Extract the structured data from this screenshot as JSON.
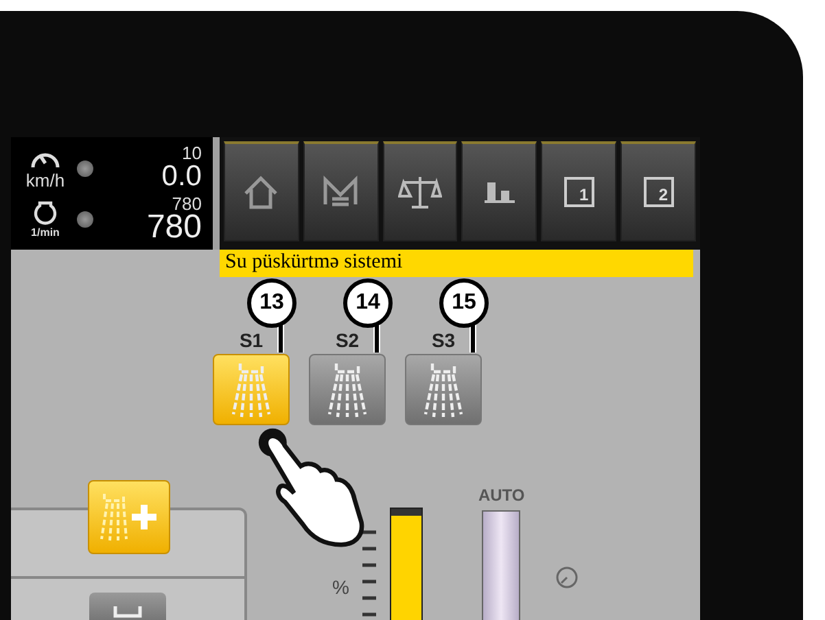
{
  "speed": {
    "target": "10",
    "value": "0.0",
    "unit": "km/h"
  },
  "engine": {
    "target": "780",
    "value": "780",
    "unit": "1/min"
  },
  "toolbar": [
    {
      "kind": "home"
    },
    {
      "kind": "menu"
    },
    {
      "kind": "scale"
    },
    {
      "kind": "chart"
    },
    {
      "kind": "page",
      "label": "1"
    },
    {
      "kind": "page",
      "label": "2"
    }
  ],
  "title": "Su püskürtmə sistemi",
  "sections": [
    {
      "label": "S1",
      "on": true,
      "callout": "13"
    },
    {
      "label": "S2",
      "on": false,
      "callout": "14"
    },
    {
      "label": "S3",
      "on": false,
      "callout": "15"
    }
  ],
  "gauge": {
    "unit": "%",
    "level": 0.95
  },
  "auto": {
    "label": "AUTO"
  }
}
